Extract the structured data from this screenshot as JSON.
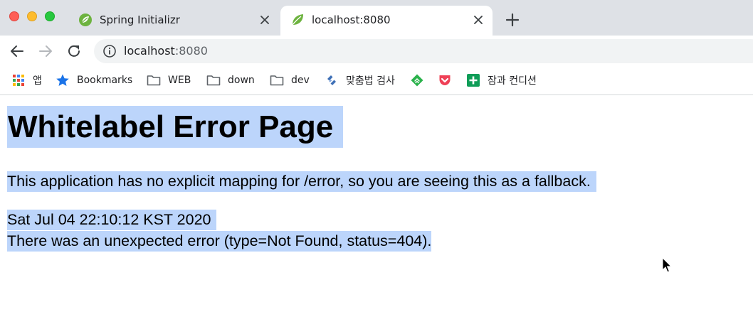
{
  "tabs": [
    {
      "title": "Spring Initializr",
      "favicon": "spring-leaf-icon",
      "active": false
    },
    {
      "title": "localhost:8080",
      "favicon": "spring-leaf-icon",
      "active": true
    }
  ],
  "toolbar": {
    "url_host": "localhost",
    "url_port": ":8080"
  },
  "bookmarks": [
    {
      "label": "앱",
      "icon": "apps-grid-icon"
    },
    {
      "label": "Bookmarks",
      "icon": "star-icon"
    },
    {
      "label": "WEB",
      "icon": "folder-icon"
    },
    {
      "label": "down",
      "icon": "folder-icon"
    },
    {
      "label": "dev",
      "icon": "folder-icon"
    },
    {
      "label": "맞춤법 검사",
      "icon": "spell-check-icon"
    },
    {
      "label": "",
      "icon": "feedly-icon"
    },
    {
      "label": "",
      "icon": "pocket-icon"
    },
    {
      "label": "잠과 컨디션",
      "icon": "sheets-plus-icon"
    }
  ],
  "page": {
    "title": "Whitelabel Error Page",
    "message": "This application has no explicit mapping for /error, so you are seeing this as a fallback.",
    "timestamp": "Sat Jul 04 22:10:12 KST 2020",
    "error": "There was an unexpected error (type=Not Found, status=404)."
  },
  "colors": {
    "selection_highlight": "#bcd5fb",
    "tab_strip": "#dee1e6",
    "omnibox": "#f1f3f4"
  }
}
